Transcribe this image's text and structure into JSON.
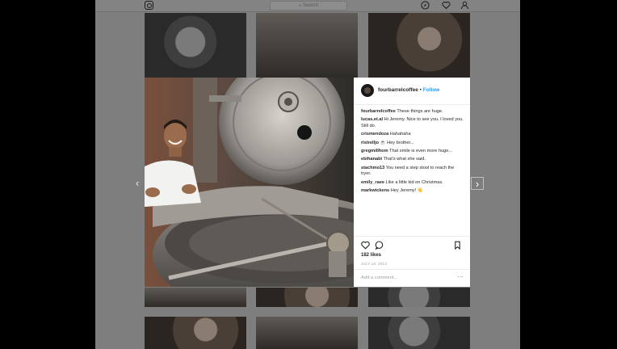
{
  "topbar": {
    "logo_icon": "instagram-icon",
    "search_placeholder": "Search",
    "icons": [
      "compass-icon",
      "heart-icon",
      "person-icon"
    ]
  },
  "post": {
    "username": "fourbarrelcoffee",
    "separator": "•",
    "follow_label": "Follow",
    "comments": [
      {
        "user": "fourbarrelcoffee",
        "text": "These things are huge."
      },
      {
        "user": "lucas.et.al",
        "text": "Hi Jeremy. Nice to see you. I loved you. Still do."
      },
      {
        "user": "crismendoza",
        "text": "Hahahaha"
      },
      {
        "user": "rlstrelljo",
        "text": "☕ Hey brother..."
      },
      {
        "user": "gregmillhom",
        "text": "That smile is even more huge..."
      },
      {
        "user": "ebihanabi",
        "text": "That's what she said."
      },
      {
        "user": "stachmo13",
        "text": "You need a step stool to reach the tryer."
      },
      {
        "user": "emily_raee",
        "text": "Like a little kid on Christmas."
      },
      {
        "user": "markwickens",
        "text": "Hey Jeremy! 👋"
      }
    ],
    "likes": "182 likes",
    "date": "JULY 18, 2013",
    "add_comment_placeholder": "Add a comment...",
    "more_icon": "ellipsis-icon",
    "action_icons": [
      "heart-icon",
      "comment-icon",
      "bookmark-icon"
    ]
  },
  "nav": {
    "prev_icon": "chevron-left-icon",
    "next_icon": "chevron-right-icon"
  },
  "colors": {
    "link": "#3897f0",
    "text": "#262626",
    "overlay": "#7e7e7e"
  }
}
